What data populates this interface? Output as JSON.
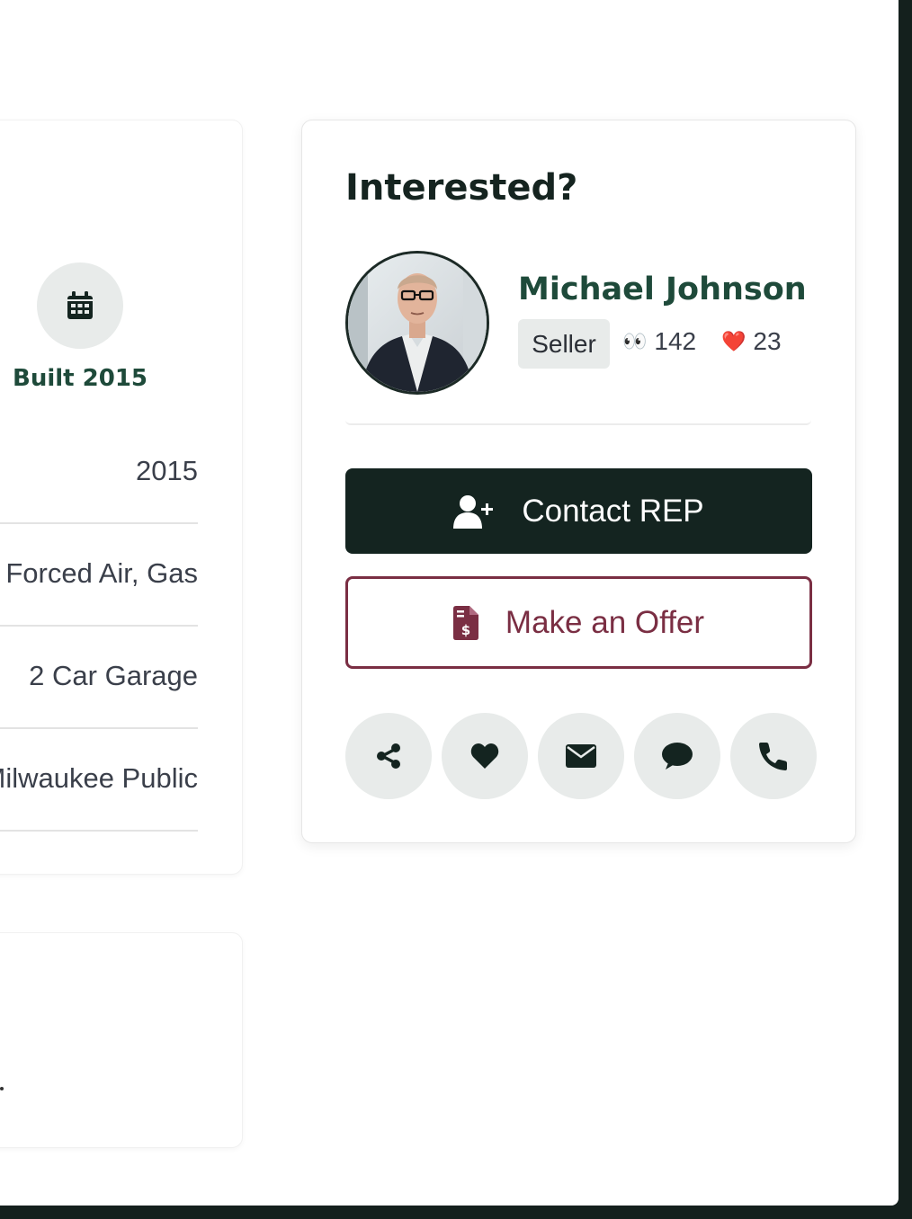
{
  "left_panel": {
    "built_label": "Built 2015",
    "features": [
      "2015",
      "Forced Air, Gas",
      "2 Car Garage",
      "Milwaukee Public"
    ],
    "icon": "calendar-icon"
  },
  "contact_card": {
    "title": "Interested?",
    "rep_name": "Michael Johnson",
    "role_badge": "Seller",
    "views_emoji": "👀",
    "views_count": "142",
    "likes_emoji": "❤️",
    "likes_count": "23",
    "contact_button": "Contact REP",
    "offer_button": "Make an Offer",
    "action_icons": [
      "share-icon",
      "heart-icon",
      "envelope-icon",
      "chat-icon",
      "phone-icon"
    ]
  },
  "colors": {
    "primary_dark": "#142420",
    "brand_green": "#1e4a3a",
    "offer_maroon": "#7a2e43",
    "chip_gray": "#e8ebea"
  }
}
